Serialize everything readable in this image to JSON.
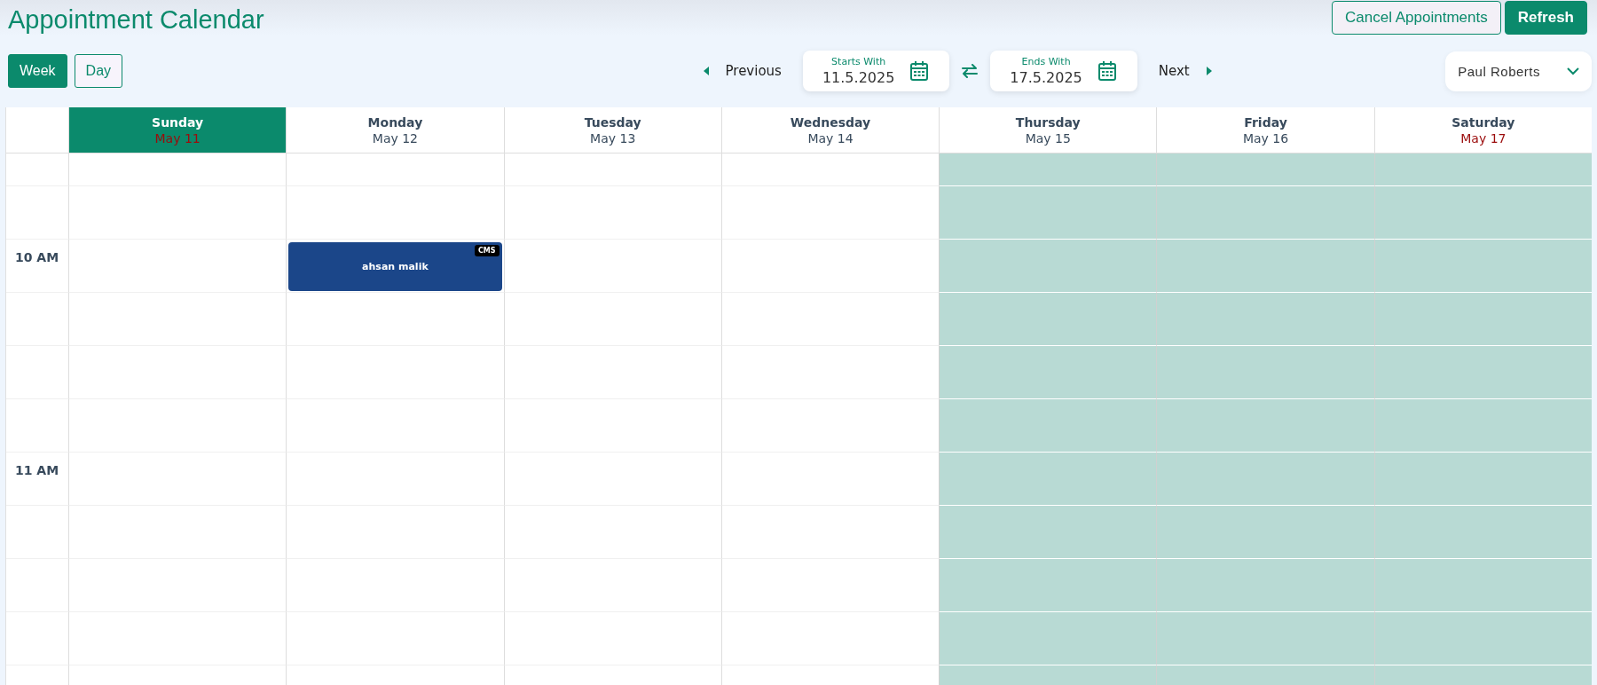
{
  "title": "Appointment Calendar",
  "actions": [
    {
      "label": "Cancel Appointments",
      "kind": "outline"
    },
    {
      "label": "Refresh",
      "kind": "primary"
    }
  ],
  "views": [
    {
      "label": "Week",
      "selected": true
    },
    {
      "label": "Day",
      "selected": false
    }
  ],
  "navigation": {
    "previous": "Previous",
    "next": "Next",
    "start": {
      "label": "Starts With",
      "value": "11.5.2025"
    },
    "end": {
      "label": "Ends With",
      "value": "17.5.2025"
    }
  },
  "staff_select": {
    "value": "Paul Roberts"
  },
  "days": [
    {
      "name": "Sunday",
      "date": "May 11",
      "selected": true,
      "weekend": true
    },
    {
      "name": "Monday",
      "date": "May 12",
      "selected": false,
      "weekend": false
    },
    {
      "name": "Tuesday",
      "date": "May 13",
      "selected": false,
      "weekend": false
    },
    {
      "name": "Wednesday",
      "date": "May 14",
      "selected": false,
      "weekend": false
    },
    {
      "name": "Thursday",
      "date": "May 15",
      "selected": false,
      "weekend": false
    },
    {
      "name": "Friday",
      "date": "May 16",
      "selected": false,
      "weekend": false
    },
    {
      "name": "Saturday",
      "date": "May 17",
      "selected": false,
      "weekend": true
    }
  ],
  "rows": [
    {
      "slots": [
        {
          "unavailable": false
        },
        {
          "unavailable": false
        },
        {
          "unavailable": false
        },
        {
          "unavailable": false
        },
        {
          "unavailable": true
        },
        {
          "unavailable": true
        },
        {
          "unavailable": true
        }
      ]
    },
    {
      "slots": [
        {
          "unavailable": false
        },
        {
          "unavailable": false
        },
        {
          "unavailable": false
        },
        {
          "unavailable": false
        },
        {
          "unavailable": true
        },
        {
          "unavailable": true
        },
        {
          "unavailable": true
        }
      ]
    },
    {
      "label": "10 AM",
      "slots": [
        {
          "unavailable": false
        },
        {
          "unavailable": false,
          "appointment": {
            "title": "ahsan malik",
            "tag": "CMS",
            "color": "#1b4689"
          }
        },
        {
          "unavailable": false
        },
        {
          "unavailable": false
        },
        {
          "unavailable": true
        },
        {
          "unavailable": true
        },
        {
          "unavailable": true
        }
      ]
    },
    {
      "slots": [
        {
          "unavailable": false
        },
        {
          "unavailable": false
        },
        {
          "unavailable": false
        },
        {
          "unavailable": false
        },
        {
          "unavailable": true
        },
        {
          "unavailable": true
        },
        {
          "unavailable": true
        }
      ]
    },
    {
      "slots": [
        {
          "unavailable": false
        },
        {
          "unavailable": false
        },
        {
          "unavailable": false
        },
        {
          "unavailable": false
        },
        {
          "unavailable": true
        },
        {
          "unavailable": true
        },
        {
          "unavailable": true
        }
      ]
    },
    {
      "slots": [
        {
          "unavailable": false
        },
        {
          "unavailable": false
        },
        {
          "unavailable": false
        },
        {
          "unavailable": false
        },
        {
          "unavailable": true
        },
        {
          "unavailable": true
        },
        {
          "unavailable": true
        }
      ]
    },
    {
      "label": "11 AM",
      "slots": [
        {
          "unavailable": false
        },
        {
          "unavailable": false
        },
        {
          "unavailable": false
        },
        {
          "unavailable": false
        },
        {
          "unavailable": true
        },
        {
          "unavailable": true
        },
        {
          "unavailable": true
        }
      ]
    },
    {
      "slots": [
        {
          "unavailable": false
        },
        {
          "unavailable": false
        },
        {
          "unavailable": false
        },
        {
          "unavailable": false
        },
        {
          "unavailable": true
        },
        {
          "unavailable": true
        },
        {
          "unavailable": true
        }
      ]
    },
    {
      "slots": [
        {
          "unavailable": false
        },
        {
          "unavailable": false
        },
        {
          "unavailable": false
        },
        {
          "unavailable": false
        },
        {
          "unavailable": true
        },
        {
          "unavailable": true
        },
        {
          "unavailable": true
        }
      ]
    },
    {
      "slots": [
        {
          "unavailable": false
        },
        {
          "unavailable": false
        },
        {
          "unavailable": false
        },
        {
          "unavailable": false
        },
        {
          "unavailable": true
        },
        {
          "unavailable": true
        },
        {
          "unavailable": true
        }
      ]
    },
    {
      "slots": [
        {
          "unavailable": false
        },
        {
          "unavailable": false
        },
        {
          "unavailable": false
        },
        {
          "unavailable": false
        },
        {
          "unavailable": true
        },
        {
          "unavailable": true
        },
        {
          "unavailable": true
        }
      ]
    }
  ]
}
